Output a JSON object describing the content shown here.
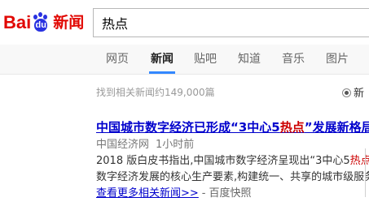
{
  "logo": {
    "part1": "Bai",
    "part2": "du",
    "paw_text": "du",
    "product": "新闻"
  },
  "search": {
    "value": "热点"
  },
  "tabs": [
    {
      "label": "网页",
      "active": false
    },
    {
      "label": "新闻",
      "active": true
    },
    {
      "label": "贴吧",
      "active": false
    },
    {
      "label": "知道",
      "active": false
    },
    {
      "label": "音乐",
      "active": false
    },
    {
      "label": "图片",
      "active": false
    }
  ],
  "results_count": "找到相关新闻约149,000篇",
  "sort_option": {
    "label": "新"
  },
  "result": {
    "title_before": "中国城市数字经济已形成“3中心5",
    "title_highlight": "热点",
    "title_after": "”发展新格局",
    "source": "中国经济网",
    "time": "1小时前",
    "abstract_line1_before": "2018 版白皮书指出,中国城市数字经济呈现出“3中心5",
    "abstract_line1_highlight": "热点",
    "abstract_line1_after": "”",
    "abstract_line2": "数字经济发展的核心生产要素,构建统一、共享的城市级服务",
    "more_link": "查看更多相关新闻>>",
    "separator": "-",
    "snapshot": "百度快照"
  },
  "colors": {
    "brand_red": "#e10601",
    "brand_blue": "#2932e1",
    "link": "#0000cc",
    "highlight": "#cc0000",
    "active_tab_underline": "#3388ff"
  }
}
